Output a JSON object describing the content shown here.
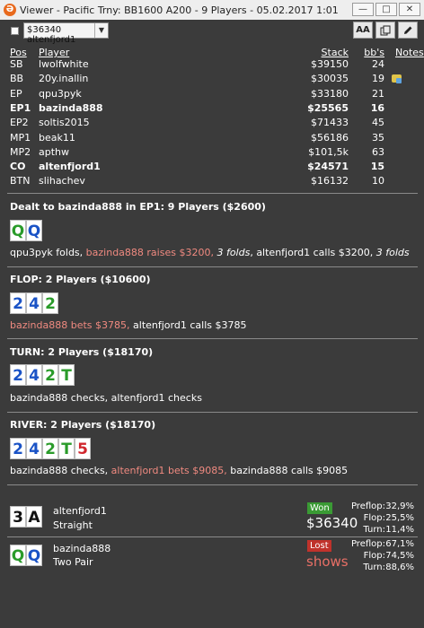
{
  "window": {
    "title": "Viewer - Pacific Trny: BB1600 A200 - 9 Players - 05.02.2017 1:01",
    "app_icon": "Ə"
  },
  "toolbar": {
    "hand_select_value": "$36340 altenfjord1",
    "font_button_label": "AA"
  },
  "table_header": {
    "pos": "Pos",
    "player": "Player",
    "stack": "Stack",
    "bbs": "bb's",
    "notes": "Notes"
  },
  "players": [
    {
      "pos": "SB",
      "player": "lwolfwhite",
      "stack": "$39150",
      "bbs": "24",
      "bold": false
    },
    {
      "pos": "BB",
      "player": "20y.inallin",
      "stack": "$30035",
      "bbs": "19",
      "bold": false
    },
    {
      "pos": "EP",
      "player": "qpu3pyk",
      "stack": "$33180",
      "bbs": "21",
      "bold": false
    },
    {
      "pos": "EP1",
      "player": "bazinda888",
      "stack": "$25565",
      "bbs": "16",
      "bold": true
    },
    {
      "pos": "EP2",
      "player": "soltis2015",
      "stack": "$71433",
      "bbs": "45",
      "bold": false
    },
    {
      "pos": "MP1",
      "player": "beak11",
      "stack": "$56186",
      "bbs": "35",
      "bold": false
    },
    {
      "pos": "MP2",
      "player": "apthw",
      "stack": "$101,5k",
      "bbs": "63",
      "bold": false
    },
    {
      "pos": "CO",
      "player": "altenfjord1",
      "stack": "$24571",
      "bbs": "15",
      "bold": true
    },
    {
      "pos": "BTN",
      "player": "slihachev",
      "stack": "$16132",
      "bbs": "10",
      "bold": false
    }
  ],
  "preflop": {
    "title": "Dealt to bazinda888 in EP1: 9 Players ($2600)",
    "cards": [
      {
        "rank": "Q",
        "suit": "clubs"
      },
      {
        "rank": "Q",
        "suit": "diamonds"
      }
    ],
    "action": {
      "a": "qpu3pyk folds, ",
      "b": "bazinda888 raises $3200, ",
      "c": "3 folds",
      "d": ", altenfjord1 calls $3200, ",
      "e": "3 folds"
    }
  },
  "flop": {
    "title": "FLOP: 2 Players ($10600)",
    "cards": [
      {
        "rank": "2",
        "suit": "diamonds"
      },
      {
        "rank": "4",
        "suit": "diamonds"
      },
      {
        "rank": "2",
        "suit": "clubs"
      }
    ],
    "action": {
      "a": "bazinda888 bets $3785, ",
      "b": "altenfjord1 calls $3785"
    }
  },
  "turn": {
    "title": "TURN: 2 Players ($18170)",
    "cards": [
      {
        "rank": "2",
        "suit": "diamonds"
      },
      {
        "rank": "4",
        "suit": "diamonds"
      },
      {
        "rank": "2",
        "suit": "clubs"
      },
      {
        "rank": "T",
        "suit": "clubs"
      }
    ],
    "action": {
      "a": "bazinda888 checks, altenfjord1 checks"
    }
  },
  "river": {
    "title": "RIVER: 2 Players ($18170)",
    "cards": [
      {
        "rank": "2",
        "suit": "diamonds"
      },
      {
        "rank": "4",
        "suit": "diamonds"
      },
      {
        "rank": "2",
        "suit": "clubs"
      },
      {
        "rank": "T",
        "suit": "clubs"
      },
      {
        "rank": "5",
        "suit": "hearts"
      }
    ],
    "action": {
      "a": "bazinda888 checks, ",
      "b": "altenfjord1 bets $9085, ",
      "c": "bazinda888 calls $9085"
    }
  },
  "results": [
    {
      "player": "altenfjord1",
      "hand": "Straight",
      "cards": [
        {
          "rank": "3",
          "suit": "spades"
        },
        {
          "rank": "A",
          "suit": "spades"
        }
      ],
      "badge": "Won",
      "amount": "$36340",
      "stats": [
        {
          "label": "Preflop:",
          "value": "32,9%"
        },
        {
          "label": "Flop:",
          "value": "25,5%"
        },
        {
          "label": "Turn:",
          "value": "11,4%"
        }
      ]
    },
    {
      "player": "bazinda888",
      "hand": "Two Pair",
      "cards": [
        {
          "rank": "Q",
          "suit": "clubs"
        },
        {
          "rank": "Q",
          "suit": "diamonds"
        }
      ],
      "badge": "Lost",
      "amount": "shows",
      "stats": [
        {
          "label": "Preflop:",
          "value": "67,1%"
        },
        {
          "label": "Flop:",
          "value": "74,5%"
        },
        {
          "label": "Turn:",
          "value": "88,6%"
        }
      ]
    }
  ],
  "colors": {
    "background": "#3b3b3b",
    "action_highlight": "#f08a80",
    "won_badge": "#3a9a34",
    "lost_badge": "#c0322b",
    "diamonds": "#1a53c6",
    "clubs": "#2a9b2a",
    "hearts": "#d0262d",
    "spades": "#111111"
  }
}
